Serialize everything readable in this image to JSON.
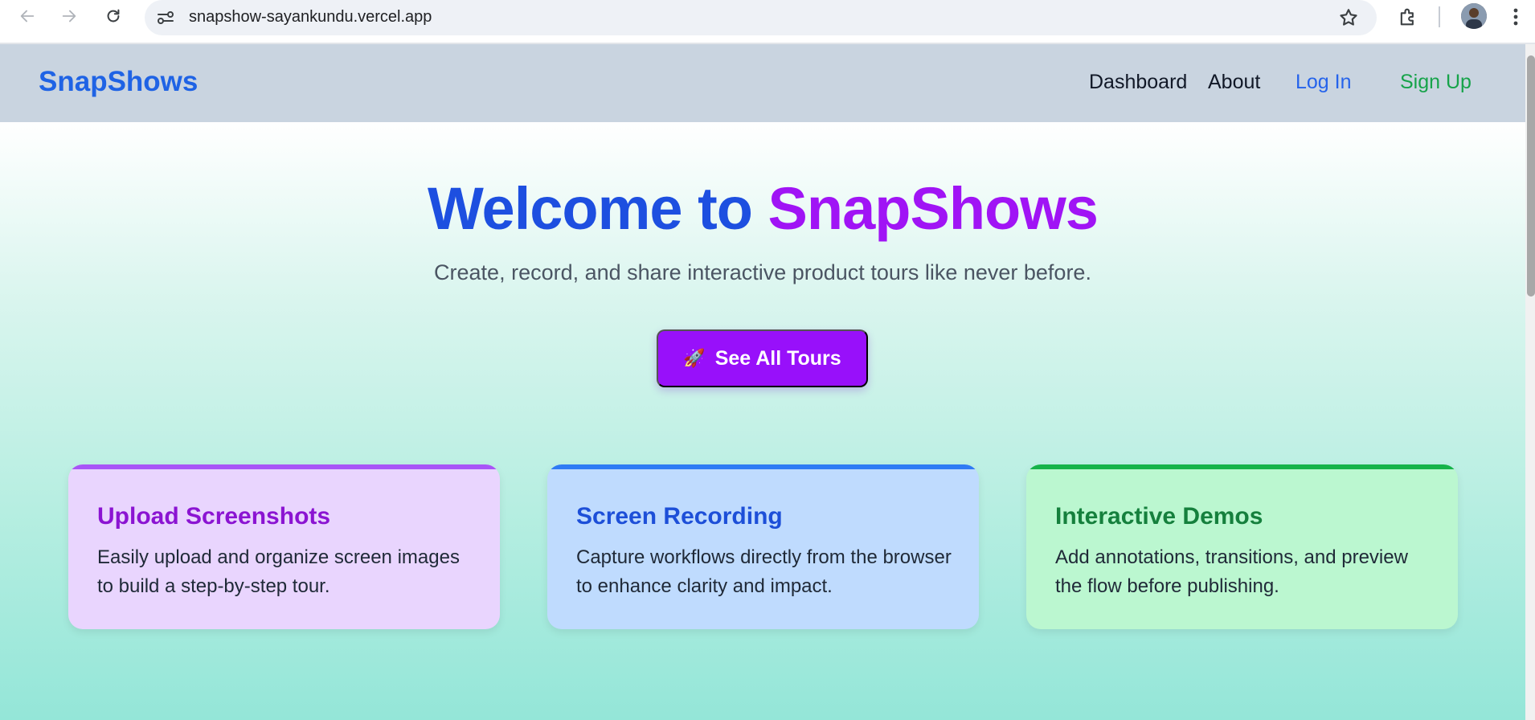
{
  "browser": {
    "url": "snapshow-sayankundu.vercel.app",
    "icons": [
      "back-icon",
      "forward-icon",
      "reload-icon",
      "site-info-icon",
      "star-icon",
      "extensions-icon",
      "avatar",
      "menu-icon"
    ]
  },
  "header": {
    "brand": "SnapShows",
    "nav": {
      "dashboard": "Dashboard",
      "about": "About",
      "login": "Log In",
      "signup": "Sign Up"
    }
  },
  "hero": {
    "title_part1": "Welcome to ",
    "title_part2": "SnapShows",
    "subtitle": "Create, record, and share interactive product tours like never before.",
    "cta_icon": "🚀",
    "cta_label": "See All Tours"
  },
  "features": [
    {
      "title": "Upload Screenshots",
      "text": "Easily upload and organize screen images to build a step-by-step tour."
    },
    {
      "title": "Screen Recording",
      "text": "Capture workflows directly from the browser to enhance clarity and impact."
    },
    {
      "title": "Interactive Demos",
      "text": "Add annotations, transitions, and preview the flow before publishing."
    }
  ],
  "colors": {
    "brand": "#1f63e5",
    "accent_purple": "#9810fa",
    "header_bg": "#c9d4e0",
    "login": "#2563eb",
    "signup": "#16a34a"
  }
}
